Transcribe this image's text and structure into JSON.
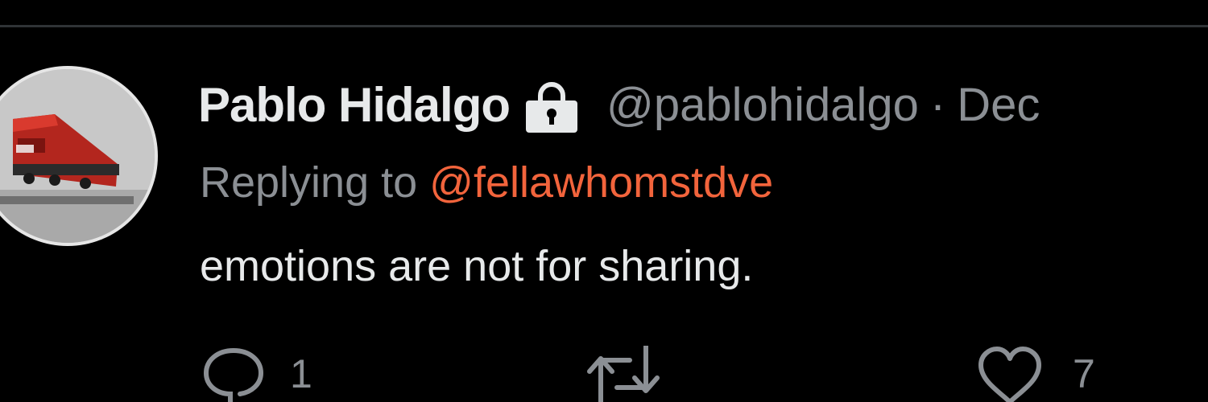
{
  "tweet": {
    "display_name": "Pablo Hidalgo",
    "protected_icon": "lock-icon",
    "handle": "@pablohidalgo",
    "separator": "·",
    "date": "Dec",
    "reply_prefix": "Replying to",
    "reply_mention": "@fellawhomstdve",
    "text": "emotions are not for sharing.",
    "avatar_icon": "train-avatar"
  },
  "actions": {
    "reply": {
      "icon": "reply-icon",
      "count": "1"
    },
    "retweet": {
      "icon": "retweet-icon",
      "count": ""
    },
    "like": {
      "icon": "heart-icon",
      "count": "7"
    }
  },
  "colors": {
    "background": "#000000",
    "primary_text": "#e7e9ea",
    "secondary_text": "#8b8f94",
    "mention": "#f2643c",
    "divider": "#2f3336"
  }
}
